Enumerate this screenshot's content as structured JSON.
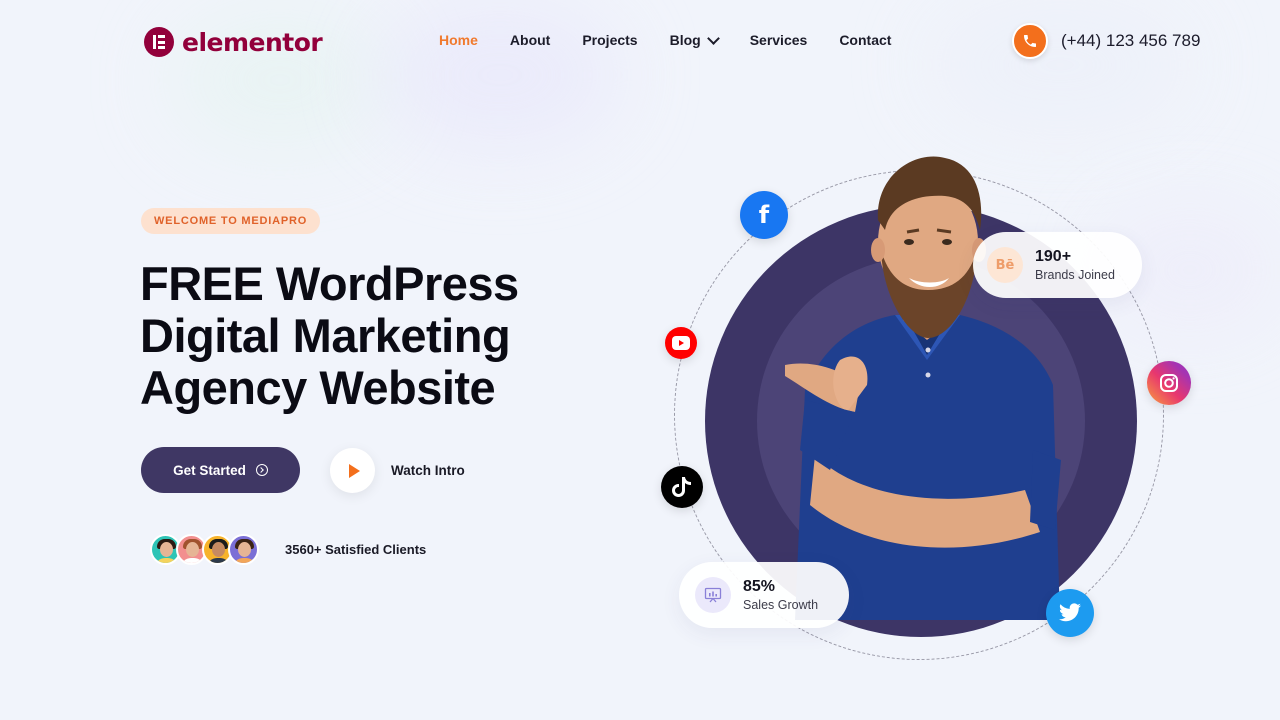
{
  "brand": {
    "name": "elementor",
    "color": "#92003b"
  },
  "nav": {
    "items": [
      {
        "label": "Home",
        "active": true
      },
      {
        "label": "About"
      },
      {
        "label": "Projects"
      },
      {
        "label": "Blog",
        "has_dropdown": true
      },
      {
        "label": "Services"
      },
      {
        "label": "Contact"
      }
    ],
    "accent_color": "#f07a2e"
  },
  "contact": {
    "phone": "(+44) 123 456 789",
    "icon": "phone-icon"
  },
  "hero": {
    "badge": "WELCOME TO MEDIAPRO",
    "title_lines": [
      "FREE WordPress",
      "Digital Marketing",
      "Agency Website"
    ],
    "cta_label": "Get Started",
    "watch_label": "Watch Intro",
    "clients_text": "3560+ Satisfied Clients"
  },
  "stats": {
    "brands": {
      "value": "190+",
      "label": "Brands Joined",
      "icon": "behance-icon",
      "icon_text": "Bē"
    },
    "sales": {
      "value": "85%",
      "label": "Sales Growth",
      "icon": "presentation-chart-icon"
    }
  },
  "social": [
    "facebook-icon",
    "youtube-icon",
    "tiktok-icon",
    "instagram-icon",
    "twitter-icon"
  ],
  "colors": {
    "primary": "#3f3764",
    "orange": "#f36f1c",
    "background": "#f1f4fb"
  }
}
